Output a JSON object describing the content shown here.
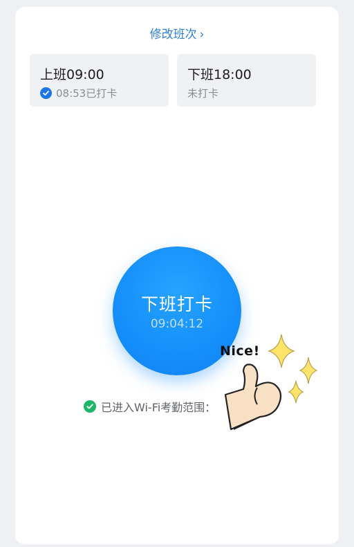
{
  "header": {
    "modify_shift_label": "修改班次"
  },
  "shifts": [
    {
      "title": "上班09:00",
      "status": "08:53已打卡",
      "done": true
    },
    {
      "title": "下班18:00",
      "status": "未打卡",
      "done": false
    }
  ],
  "punch": {
    "label": "下班打卡",
    "time": "09:04:12"
  },
  "wifi": {
    "status_text": "已进入Wi-Fi考勤范围："
  },
  "sticker": {
    "text": "Nice!"
  },
  "colors": {
    "accent": "#2f80d8",
    "button": "#1690fb",
    "success": "#1cb76a"
  }
}
